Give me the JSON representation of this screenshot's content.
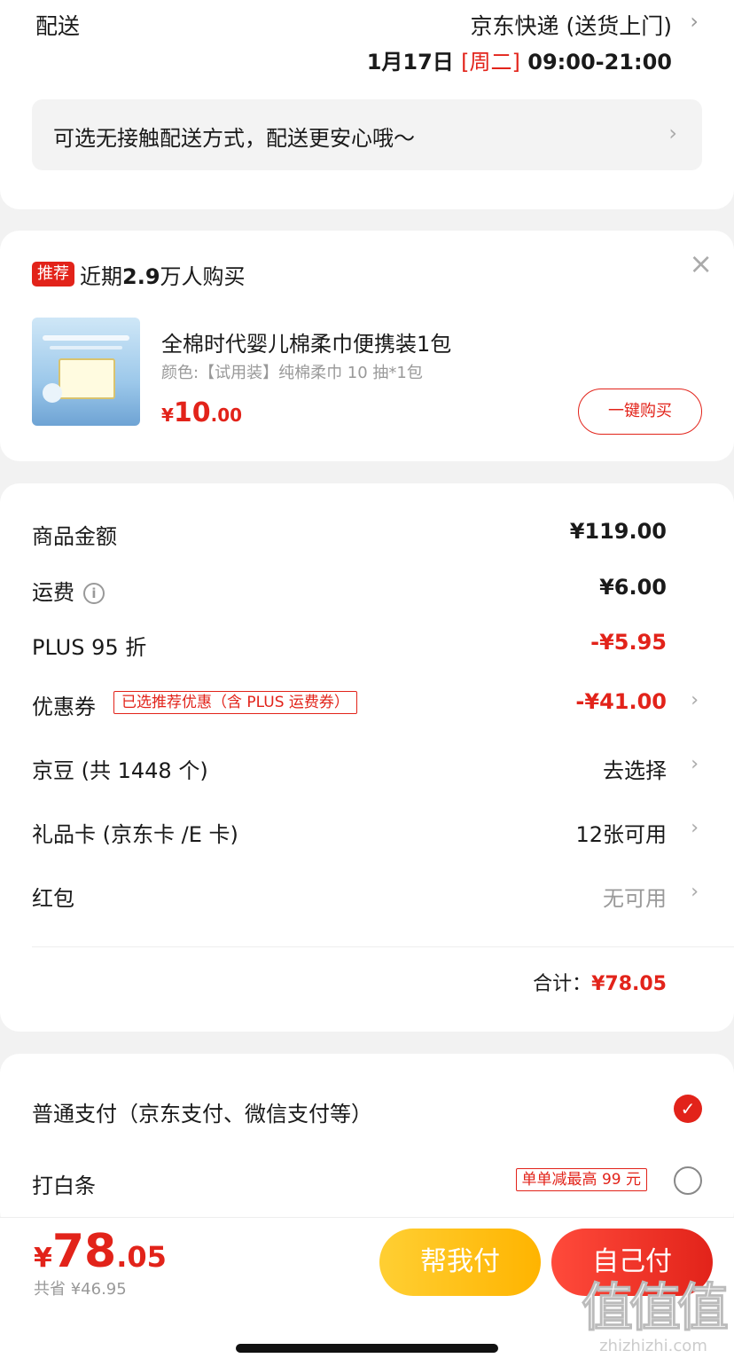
{
  "delivery": {
    "label": "配送",
    "method": "京东快递 (送货上门)",
    "date": "1月17日",
    "weekday": "[周二]",
    "time_range": "09:00-21:00",
    "contactless": "可选无接触配送方式，配送更安心哦～"
  },
  "recommend": {
    "badge": "推荐",
    "title_prefix": "近期",
    "title_count": "2.9",
    "title_suffix": "万人购买",
    "close": "×",
    "product_name": "全棉时代婴儿棉柔巾便携装1包",
    "product_spec": "颜色:【试用装】纯棉柔巾 10 抽*1包",
    "price_currency": "¥",
    "price_int": "10",
    "price_dec": ".00",
    "buy_button": "一键购买"
  },
  "summary": {
    "goods_label": "商品金额",
    "goods_value": "¥119.00",
    "shipping_label": "运费",
    "shipping_value": "¥6.00",
    "plus_label": "PLUS 95 折",
    "plus_value": "-¥5.95",
    "coupon_label": "优惠券",
    "coupon_tag": "已选推荐优惠（含 PLUS 运费券）",
    "coupon_value": "-¥41.00",
    "jingdou_label": "京豆 (共 1448 个)",
    "jingdou_value": "去选择",
    "giftcard_label": "礼品卡 (京东卡 /E 卡)",
    "giftcard_value": "12张可用",
    "redpacket_label": "红包",
    "redpacket_value": "无可用",
    "total_label": "合计：",
    "total_value": "¥78.05"
  },
  "payment": {
    "normal_label": "普通支付（京东支付、微信支付等）",
    "baitiao_label": "打白条",
    "baitiao_tag": "单单减最高 99 元"
  },
  "bottom": {
    "price_currency": "¥",
    "price_int": "78",
    "price_dec": ".05",
    "saved": "共省 ¥46.95",
    "help_pay": "帮我付",
    "self_pay": "自己付"
  },
  "watermark": {
    "big": "值值值",
    "small": "zhizhizhi.com"
  },
  "colors": {
    "accent_red": "#e2231a",
    "help_yellow": "#ffbd1a"
  }
}
